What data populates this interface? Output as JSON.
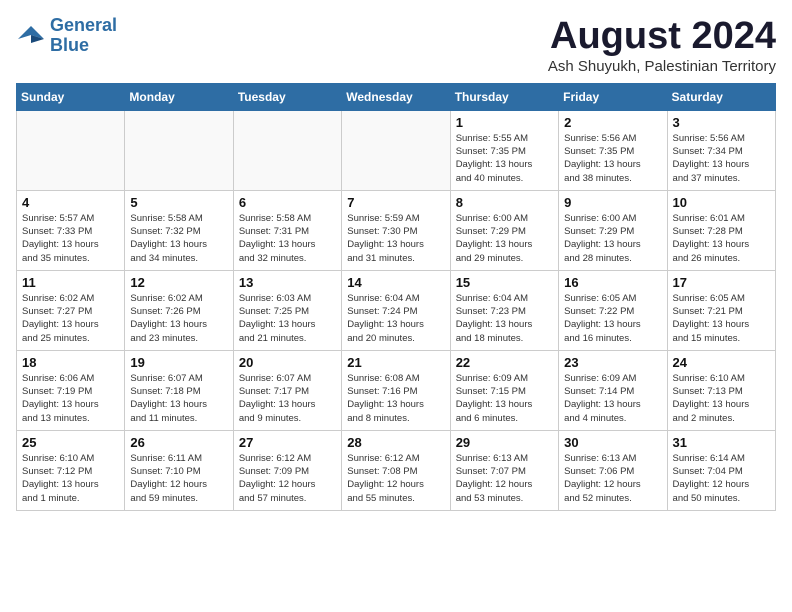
{
  "header": {
    "logo_line1": "General",
    "logo_line2": "Blue",
    "month": "August 2024",
    "location": "Ash Shuyukh, Palestinian Territory"
  },
  "weekdays": [
    "Sunday",
    "Monday",
    "Tuesday",
    "Wednesday",
    "Thursday",
    "Friday",
    "Saturday"
  ],
  "weeks": [
    [
      {
        "day": "",
        "info": ""
      },
      {
        "day": "",
        "info": ""
      },
      {
        "day": "",
        "info": ""
      },
      {
        "day": "",
        "info": ""
      },
      {
        "day": "1",
        "info": "Sunrise: 5:55 AM\nSunset: 7:35 PM\nDaylight: 13 hours\nand 40 minutes."
      },
      {
        "day": "2",
        "info": "Sunrise: 5:56 AM\nSunset: 7:35 PM\nDaylight: 13 hours\nand 38 minutes."
      },
      {
        "day": "3",
        "info": "Sunrise: 5:56 AM\nSunset: 7:34 PM\nDaylight: 13 hours\nand 37 minutes."
      }
    ],
    [
      {
        "day": "4",
        "info": "Sunrise: 5:57 AM\nSunset: 7:33 PM\nDaylight: 13 hours\nand 35 minutes."
      },
      {
        "day": "5",
        "info": "Sunrise: 5:58 AM\nSunset: 7:32 PM\nDaylight: 13 hours\nand 34 minutes."
      },
      {
        "day": "6",
        "info": "Sunrise: 5:58 AM\nSunset: 7:31 PM\nDaylight: 13 hours\nand 32 minutes."
      },
      {
        "day": "7",
        "info": "Sunrise: 5:59 AM\nSunset: 7:30 PM\nDaylight: 13 hours\nand 31 minutes."
      },
      {
        "day": "8",
        "info": "Sunrise: 6:00 AM\nSunset: 7:29 PM\nDaylight: 13 hours\nand 29 minutes."
      },
      {
        "day": "9",
        "info": "Sunrise: 6:00 AM\nSunset: 7:29 PM\nDaylight: 13 hours\nand 28 minutes."
      },
      {
        "day": "10",
        "info": "Sunrise: 6:01 AM\nSunset: 7:28 PM\nDaylight: 13 hours\nand 26 minutes."
      }
    ],
    [
      {
        "day": "11",
        "info": "Sunrise: 6:02 AM\nSunset: 7:27 PM\nDaylight: 13 hours\nand 25 minutes."
      },
      {
        "day": "12",
        "info": "Sunrise: 6:02 AM\nSunset: 7:26 PM\nDaylight: 13 hours\nand 23 minutes."
      },
      {
        "day": "13",
        "info": "Sunrise: 6:03 AM\nSunset: 7:25 PM\nDaylight: 13 hours\nand 21 minutes."
      },
      {
        "day": "14",
        "info": "Sunrise: 6:04 AM\nSunset: 7:24 PM\nDaylight: 13 hours\nand 20 minutes."
      },
      {
        "day": "15",
        "info": "Sunrise: 6:04 AM\nSunset: 7:23 PM\nDaylight: 13 hours\nand 18 minutes."
      },
      {
        "day": "16",
        "info": "Sunrise: 6:05 AM\nSunset: 7:22 PM\nDaylight: 13 hours\nand 16 minutes."
      },
      {
        "day": "17",
        "info": "Sunrise: 6:05 AM\nSunset: 7:21 PM\nDaylight: 13 hours\nand 15 minutes."
      }
    ],
    [
      {
        "day": "18",
        "info": "Sunrise: 6:06 AM\nSunset: 7:19 PM\nDaylight: 13 hours\nand 13 minutes."
      },
      {
        "day": "19",
        "info": "Sunrise: 6:07 AM\nSunset: 7:18 PM\nDaylight: 13 hours\nand 11 minutes."
      },
      {
        "day": "20",
        "info": "Sunrise: 6:07 AM\nSunset: 7:17 PM\nDaylight: 13 hours\nand 9 minutes."
      },
      {
        "day": "21",
        "info": "Sunrise: 6:08 AM\nSunset: 7:16 PM\nDaylight: 13 hours\nand 8 minutes."
      },
      {
        "day": "22",
        "info": "Sunrise: 6:09 AM\nSunset: 7:15 PM\nDaylight: 13 hours\nand 6 minutes."
      },
      {
        "day": "23",
        "info": "Sunrise: 6:09 AM\nSunset: 7:14 PM\nDaylight: 13 hours\nand 4 minutes."
      },
      {
        "day": "24",
        "info": "Sunrise: 6:10 AM\nSunset: 7:13 PM\nDaylight: 13 hours\nand 2 minutes."
      }
    ],
    [
      {
        "day": "25",
        "info": "Sunrise: 6:10 AM\nSunset: 7:12 PM\nDaylight: 13 hours\nand 1 minute."
      },
      {
        "day": "26",
        "info": "Sunrise: 6:11 AM\nSunset: 7:10 PM\nDaylight: 12 hours\nand 59 minutes."
      },
      {
        "day": "27",
        "info": "Sunrise: 6:12 AM\nSunset: 7:09 PM\nDaylight: 12 hours\nand 57 minutes."
      },
      {
        "day": "28",
        "info": "Sunrise: 6:12 AM\nSunset: 7:08 PM\nDaylight: 12 hours\nand 55 minutes."
      },
      {
        "day": "29",
        "info": "Sunrise: 6:13 AM\nSunset: 7:07 PM\nDaylight: 12 hours\nand 53 minutes."
      },
      {
        "day": "30",
        "info": "Sunrise: 6:13 AM\nSunset: 7:06 PM\nDaylight: 12 hours\nand 52 minutes."
      },
      {
        "day": "31",
        "info": "Sunrise: 6:14 AM\nSunset: 7:04 PM\nDaylight: 12 hours\nand 50 minutes."
      }
    ]
  ]
}
